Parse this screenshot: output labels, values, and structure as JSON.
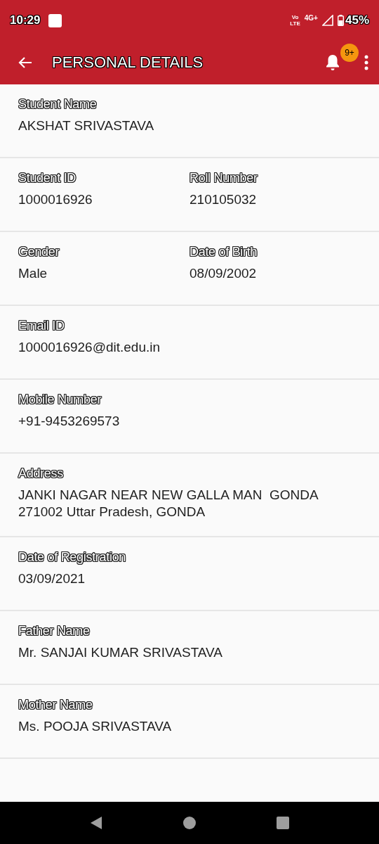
{
  "status_bar": {
    "time": "10:29",
    "volte_top": "Vo",
    "volte_bottom": "LTE",
    "network": "4G+",
    "battery": "45%"
  },
  "app_bar": {
    "title": "PERSONAL DETAILS",
    "notification_badge": "9+"
  },
  "sections": [
    {
      "fields": [
        {
          "label": "Student Name",
          "value": "AKSHAT SRIVASTAVA"
        }
      ]
    },
    {
      "fields": [
        {
          "label": "Student ID",
          "value": "1000016926"
        },
        {
          "label": "Roll Number",
          "value": "210105032"
        }
      ]
    },
    {
      "fields": [
        {
          "label": "Gender",
          "value": "Male"
        },
        {
          "label": "Date of Birth",
          "value": "08/09/2002"
        }
      ]
    },
    {
      "fields": [
        {
          "label": "Email ID",
          "value": "1000016926@dit.edu.in"
        }
      ]
    },
    {
      "fields": [
        {
          "label": "Mobile Number",
          "value": "+91-9453269573"
        }
      ]
    },
    {
      "fields": [
        {
          "label": "Address",
          "value": "JANKI NAGAR NEAR NEW GALLA MAN  GONDA 271002 Uttar Pradesh, GONDA"
        }
      ]
    },
    {
      "fields": [
        {
          "label": "Date of Registration",
          "value": "03/09/2021"
        }
      ]
    },
    {
      "fields": [
        {
          "label": "Father Name",
          "value": "Mr. SANJAI KUMAR SRIVASTAVA"
        }
      ]
    },
    {
      "fields": [
        {
          "label": "Mother Name",
          "value": "Ms. POOJA SRIVASTAVA"
        }
      ]
    }
  ]
}
